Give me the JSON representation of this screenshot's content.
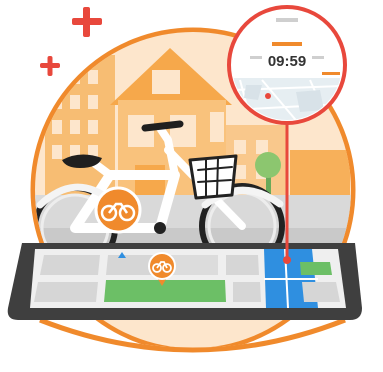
{
  "illustration": {
    "timer_value": "09:59",
    "colors": {
      "accent_orange": "#f08a2c",
      "accent_red": "#e8483c",
      "sky_peach": "#fde3c7",
      "phone_body": "#3f3f3f",
      "map_green": "#6cbf66",
      "map_blue": "#2f8fe0"
    },
    "icons": [
      "plus-icon",
      "bike-share-icon",
      "map-pin-icon",
      "magnifier-lens"
    ]
  }
}
